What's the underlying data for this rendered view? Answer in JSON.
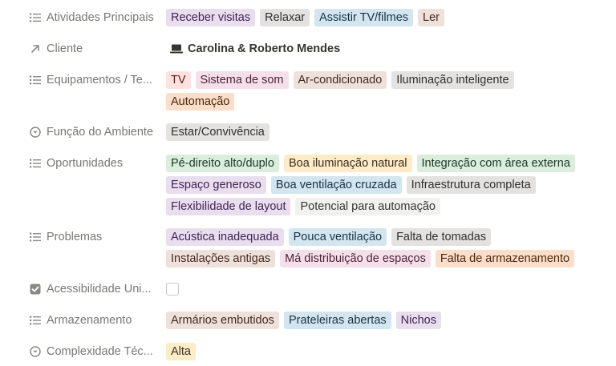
{
  "properties": {
    "atividades": {
      "label": "Atividades Principais",
      "icon": "list-icon",
      "tags": [
        {
          "text": "Receber visitas",
          "color": "purple"
        },
        {
          "text": "Relaxar",
          "color": "gray"
        },
        {
          "text": "Assistir TV/filmes",
          "color": "blue"
        },
        {
          "text": "Ler",
          "color": "brown"
        }
      ]
    },
    "cliente": {
      "label": "Cliente",
      "icon": "arrow-up-right-icon",
      "value": "Carolina & Roberto Mendes",
      "value_icon": "laptop-icon"
    },
    "equipamentos": {
      "label": "Equipamentos / Te...",
      "icon": "list-icon",
      "tags": [
        {
          "text": "TV",
          "color": "red"
        },
        {
          "text": "Sistema de som",
          "color": "pink"
        },
        {
          "text": "Ar-condicionado",
          "color": "brown"
        },
        {
          "text": "Iluminação inteligente",
          "color": "gray"
        },
        {
          "text": "Automação",
          "color": "orange"
        }
      ]
    },
    "funcao": {
      "label": "Função do Ambiente",
      "icon": "select-icon",
      "tags": [
        {
          "text": "Estar/Convivência",
          "color": "gray"
        }
      ]
    },
    "oportunidades": {
      "label": "Oportunidades",
      "icon": "list-icon",
      "tags": [
        {
          "text": "Pé-direito alto/duplo",
          "color": "green"
        },
        {
          "text": "Boa iluminação natural",
          "color": "yellow"
        },
        {
          "text": "Integração com área externa",
          "color": "green"
        },
        {
          "text": "Espaço generoso",
          "color": "purple"
        },
        {
          "text": "Boa ventilação cruzada",
          "color": "blue"
        },
        {
          "text": "Infraestrutura completa",
          "color": "gray"
        },
        {
          "text": "Flexibilidade de layout",
          "color": "purple"
        },
        {
          "text": "Potencial para automação",
          "color": "default"
        }
      ]
    },
    "problemas": {
      "label": "Problemas",
      "icon": "list-icon",
      "tags": [
        {
          "text": "Acústica inadequada",
          "color": "purple"
        },
        {
          "text": "Pouca ventilação",
          "color": "blue"
        },
        {
          "text": "Falta de tomadas",
          "color": "gray"
        },
        {
          "text": "Instalações antigas",
          "color": "brown"
        },
        {
          "text": "Má distribuição de espaços",
          "color": "pink"
        },
        {
          "text": "Falta de armazenamento",
          "color": "orange"
        }
      ]
    },
    "acessibilidade": {
      "label": "Acessibilidade Uni...",
      "icon": "checkbox-icon",
      "checked": false
    },
    "armazenamento": {
      "label": "Armazenamento",
      "icon": "list-icon",
      "tags": [
        {
          "text": "Armários embutidos",
          "color": "brown"
        },
        {
          "text": "Prateleiras abertas",
          "color": "blue"
        },
        {
          "text": "Nichos",
          "color": "purple"
        }
      ]
    },
    "complexidade": {
      "label": "Complexidade Téc...",
      "icon": "select-icon",
      "tags": [
        {
          "text": "Alta",
          "color": "yellow"
        }
      ]
    }
  }
}
